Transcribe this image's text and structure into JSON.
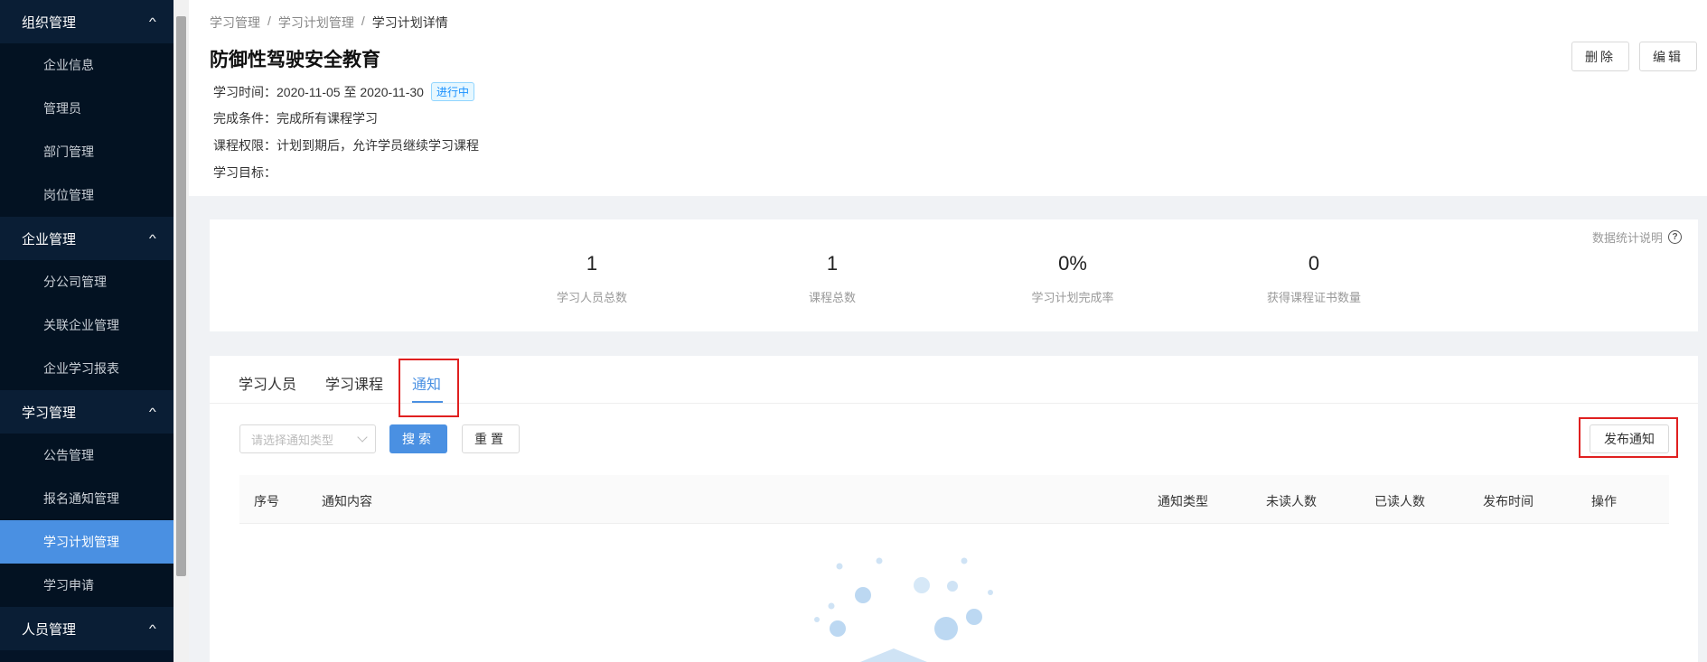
{
  "sidebar": {
    "groups": [
      {
        "label": "组织管理",
        "items": [
          "企业信息",
          "管理员",
          "部门管理",
          "岗位管理"
        ]
      },
      {
        "label": "企业管理",
        "items": [
          "分公司管理",
          "关联企业管理",
          "企业学习报表"
        ]
      },
      {
        "label": "学习管理",
        "items": [
          "公告管理",
          "报名通知管理",
          "学习计划管理",
          "学习申请"
        ]
      },
      {
        "label": "人员管理",
        "items": []
      }
    ],
    "active_item": "学习计划管理"
  },
  "breadcrumb": [
    "学习管理",
    "学习计划管理",
    "学习计划详情"
  ],
  "breadcrumb_sep": "/",
  "plan": {
    "title": "防御性驾驶安全教育",
    "time_label": "学习时间：",
    "time_value": "2020-11-05 至 2020-11-30",
    "status": "进行中",
    "condition_label": "完成条件：",
    "condition_value": "完成所有课程学习",
    "permission_label": "课程权限：",
    "permission_value": "计划到期后，允许学员继续学习课程",
    "goal_label": "学习目标：",
    "goal_value": ""
  },
  "header_actions": {
    "delete": "删除",
    "edit": "编辑"
  },
  "stats": {
    "help_text": "数据统计说明",
    "items": [
      {
        "value": "1",
        "label": "学习人员总数"
      },
      {
        "value": "1",
        "label": "课程总数"
      },
      {
        "value": "0%",
        "label": "学习计划完成率"
      },
      {
        "value": "0",
        "label": "获得课程证书数量"
      }
    ]
  },
  "tabs": [
    "学习人员",
    "学习课程",
    "通知"
  ],
  "active_tab": "通知",
  "filter": {
    "type_placeholder": "请选择通知类型",
    "search": "搜索",
    "reset": "重置",
    "publish": "发布通知"
  },
  "table": {
    "columns": [
      "序号",
      "通知内容",
      "通知类型",
      "未读人数",
      "已读人数",
      "发布时间",
      "操作"
    ],
    "rows": []
  },
  "colors": {
    "sidebar_bg": "#041427",
    "accent": "#4a90e2",
    "highlight_box": "#e02020"
  }
}
